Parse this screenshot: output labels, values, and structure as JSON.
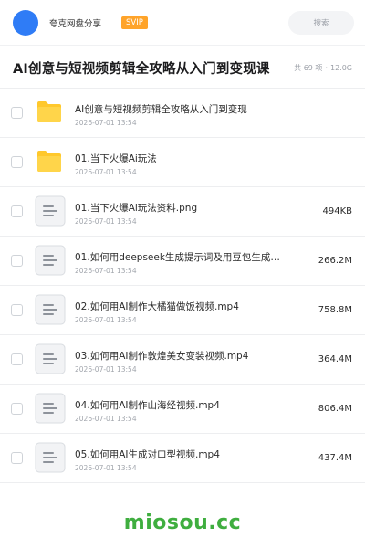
{
  "header": {
    "brand": "夸克网盘分享",
    "badge": "SVIP",
    "search_placeholder": "搜索"
  },
  "titlebar": {
    "title": "AI创意与短视频剪辑全攻略从入门到变现课",
    "item_count": "共 69 项",
    "total_size": "12.0G"
  },
  "files": [
    {
      "type": "folder",
      "name": "AI创意与短视频剪辑全攻略从入门到变现",
      "date": "2026-07-01 13:54",
      "size": ""
    },
    {
      "type": "folder",
      "name": "01.当下火爆Ai玩法",
      "date": "2026-07-01 13:54",
      "size": ""
    },
    {
      "type": "file",
      "name": "01.当下火爆Ai玩法资料.png",
      "date": "2026-07-01 13:54",
      "size": "494KB"
    },
    {
      "type": "file",
      "name": "01.如何用deepseek生成提示词及用豆包生成…",
      "date": "2026-07-01 13:54",
      "size": "266.2M"
    },
    {
      "type": "file",
      "name": "02.如何用AI制作大橘猫做饭视频.mp4",
      "date": "2026-07-01 13:54",
      "size": "758.8M"
    },
    {
      "type": "file",
      "name": "03.如何用AI制作敦煌美女变装视频.mp4",
      "date": "2026-07-01 13:54",
      "size": "364.4M"
    },
    {
      "type": "file",
      "name": "04.如何用AI制作山海经视频.mp4",
      "date": "2026-07-01 13:54",
      "size": "806.4M"
    },
    {
      "type": "file",
      "name": "05.如何用AI生成对口型视频.mp4",
      "date": "2026-07-01 13:54",
      "size": "437.4M"
    }
  ],
  "watermark": "miosou.cc",
  "colors": {
    "accent_blue": "#2f7cf6",
    "svip_orange": "#ffa42a",
    "folder_yellow": "#ffc82c",
    "watermark_green": "#3fae3f"
  }
}
